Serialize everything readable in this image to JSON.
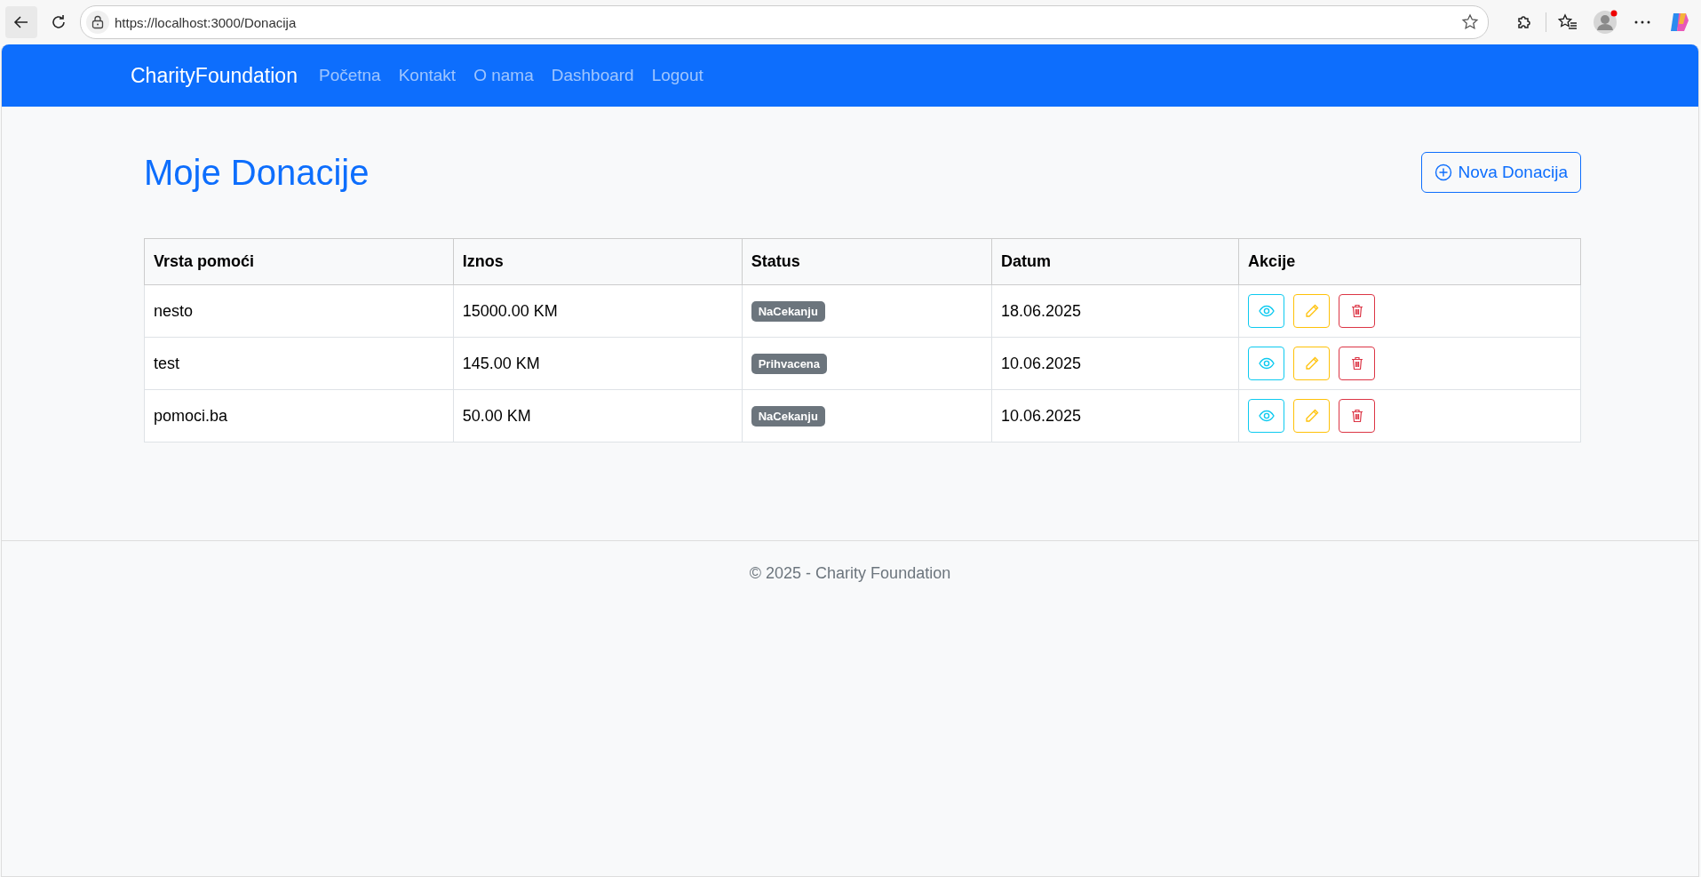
{
  "browser": {
    "url": "https://localhost:3000/Donacija"
  },
  "navbar": {
    "brand": "CharityFoundation",
    "links": [
      "Početna",
      "Kontakt",
      "O nama",
      "Dashboard",
      "Logout"
    ]
  },
  "page": {
    "title": "Moje Donacije",
    "new_button": "Nova Donacija"
  },
  "table": {
    "columns": [
      "Vrsta pomoći",
      "Iznos",
      "Status",
      "Datum",
      "Akcije"
    ],
    "rows": [
      {
        "type": "nesto",
        "amount": "15000.00 KM",
        "status": "NaCekanju",
        "date": "18.06.2025"
      },
      {
        "type": "test",
        "amount": "145.00 KM",
        "status": "Prihvacena",
        "date": "10.06.2025"
      },
      {
        "type": "pomoci.ba",
        "amount": "50.00 KM",
        "status": "NaCekanju",
        "date": "10.06.2025"
      }
    ]
  },
  "footer": {
    "text": "© 2025 - Charity Foundation"
  }
}
